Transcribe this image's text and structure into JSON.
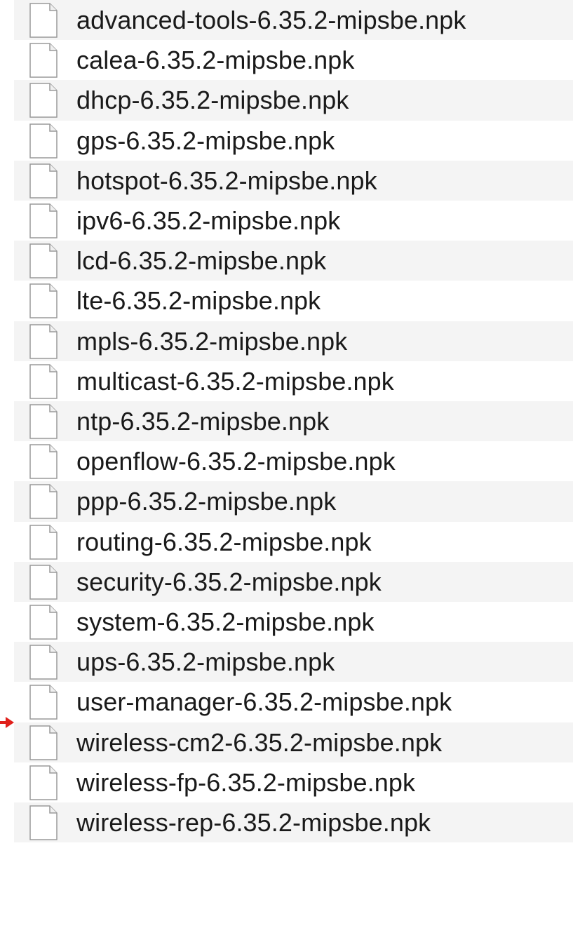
{
  "files": [
    {
      "name": "advanced-tools-6.35.2-mipsbe.npk",
      "icon": "document-icon"
    },
    {
      "name": "calea-6.35.2-mipsbe.npk",
      "icon": "document-icon"
    },
    {
      "name": "dhcp-6.35.2-mipsbe.npk",
      "icon": "document-icon"
    },
    {
      "name": "gps-6.35.2-mipsbe.npk",
      "icon": "document-icon"
    },
    {
      "name": "hotspot-6.35.2-mipsbe.npk",
      "icon": "document-icon"
    },
    {
      "name": "ipv6-6.35.2-mipsbe.npk",
      "icon": "document-icon"
    },
    {
      "name": "lcd-6.35.2-mipsbe.npk",
      "icon": "document-icon"
    },
    {
      "name": "lte-6.35.2-mipsbe.npk",
      "icon": "document-icon"
    },
    {
      "name": "mpls-6.35.2-mipsbe.npk",
      "icon": "document-icon"
    },
    {
      "name": "multicast-6.35.2-mipsbe.npk",
      "icon": "document-icon"
    },
    {
      "name": "ntp-6.35.2-mipsbe.npk",
      "icon": "document-icon"
    },
    {
      "name": "openflow-6.35.2-mipsbe.npk",
      "icon": "document-icon"
    },
    {
      "name": "ppp-6.35.2-mipsbe.npk",
      "icon": "document-icon"
    },
    {
      "name": "routing-6.35.2-mipsbe.npk",
      "icon": "document-icon"
    },
    {
      "name": "security-6.35.2-mipsbe.npk",
      "icon": "document-icon"
    },
    {
      "name": "system-6.35.2-mipsbe.npk",
      "icon": "document-icon"
    },
    {
      "name": "ups-6.35.2-mipsbe.npk",
      "icon": "document-icon"
    },
    {
      "name": "user-manager-6.35.2-mipsbe.npk",
      "icon": "document-icon"
    },
    {
      "name": "wireless-cm2-6.35.2-mipsbe.npk",
      "icon": "document-icon"
    },
    {
      "name": "wireless-fp-6.35.2-mipsbe.npk",
      "icon": "document-icon"
    },
    {
      "name": "wireless-rep-6.35.2-mipsbe.npk",
      "icon": "document-icon"
    }
  ],
  "pointer": {
    "icon": "arrow-right-icon",
    "color": "#e0201b",
    "points_to": "user-manager-6.35.2-mipsbe.npk"
  },
  "colors": {
    "row_shade": "#f4f4f4",
    "text": "#1a1a1a"
  }
}
